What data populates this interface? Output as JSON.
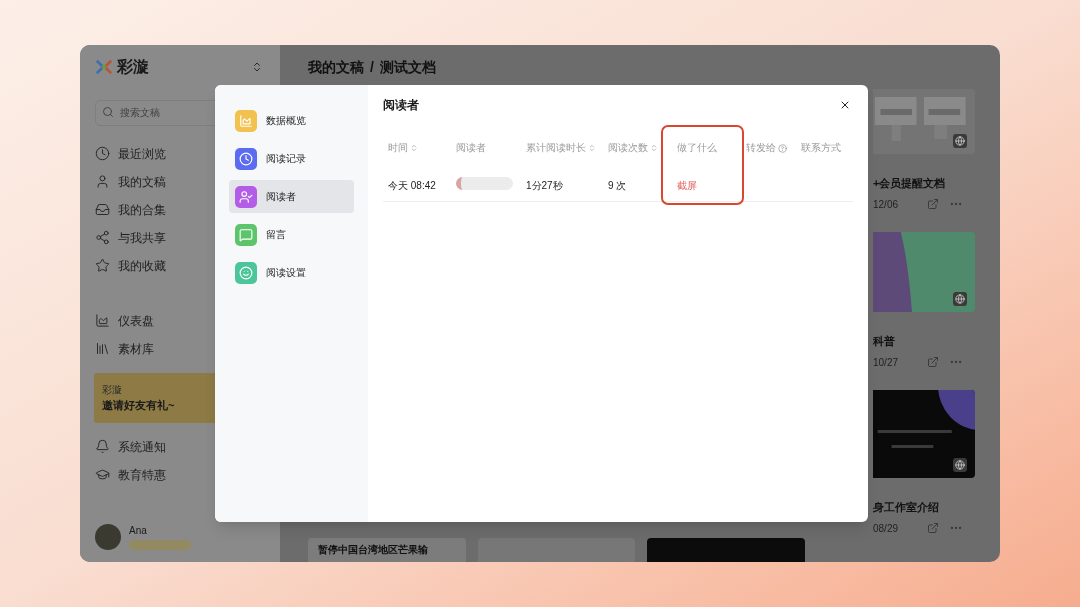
{
  "sidebar": {
    "brand": "彩漩",
    "search": {
      "placeholder": "搜索文稿"
    },
    "nav_primary": [
      {
        "label": "最近浏览"
      },
      {
        "label": "我的文稿"
      },
      {
        "label": "我的合集"
      },
      {
        "label": "与我共享"
      },
      {
        "label": "我的收藏"
      }
    ],
    "nav_secondary": [
      {
        "label": "仪表盘"
      },
      {
        "label": "素材库"
      }
    ],
    "promo": {
      "brand": "彩漩",
      "text": "邀请好友有礼~"
    },
    "nav_bottom": [
      {
        "label": "系统通知"
      },
      {
        "label": "教育特惠"
      }
    ],
    "user": {
      "name": "Ana"
    }
  },
  "breadcrumb": {
    "items": [
      "我的文稿",
      "测试文档"
    ],
    "separator": "/"
  },
  "documents": [
    {
      "title": "+会员提醒文档",
      "date": "12/06",
      "kind": "screens"
    },
    {
      "title": "科普",
      "date": "10/27",
      "kind": "split"
    },
    {
      "title": "身工作室介绍",
      "date": "08/29",
      "kind": "dark"
    }
  ],
  "bottom_cards": [
    {
      "kind": "light",
      "title": "暂停中国台湾地区芒果输"
    },
    {
      "kind": "blank"
    },
    {
      "kind": "dark"
    }
  ],
  "modal": {
    "menu": [
      {
        "label": "数据概览",
        "color": "#f2c14e",
        "selected": false
      },
      {
        "label": "阅读记录",
        "color": "#5b6cf0",
        "selected": false
      },
      {
        "label": "阅读者",
        "color": "#b25ce8",
        "selected": true
      },
      {
        "label": "留言",
        "color": "#5cc46a",
        "selected": false
      },
      {
        "label": "阅读设置",
        "color": "#4cc59a",
        "selected": false
      }
    ],
    "title": "阅读者",
    "columns": [
      {
        "label": "时间",
        "sortable": true,
        "help": false,
        "highlighted": false
      },
      {
        "label": "阅读者",
        "sortable": false,
        "help": false,
        "highlighted": false
      },
      {
        "label": "累计阅读时长",
        "sortable": true,
        "help": false,
        "highlighted": false
      },
      {
        "label": "阅读次数",
        "sortable": true,
        "help": false,
        "highlighted": false
      },
      {
        "label": "做了什么",
        "sortable": false,
        "help": false,
        "highlighted": true
      },
      {
        "label": "转发给",
        "sortable": false,
        "help": true,
        "highlighted": false
      },
      {
        "label": "联系方式",
        "sortable": false,
        "help": false,
        "highlighted": false
      }
    ],
    "rows": [
      {
        "time": "今天 08:42",
        "duration": "1分27秒",
        "count": "9 次",
        "action": "截屏"
      }
    ]
  }
}
